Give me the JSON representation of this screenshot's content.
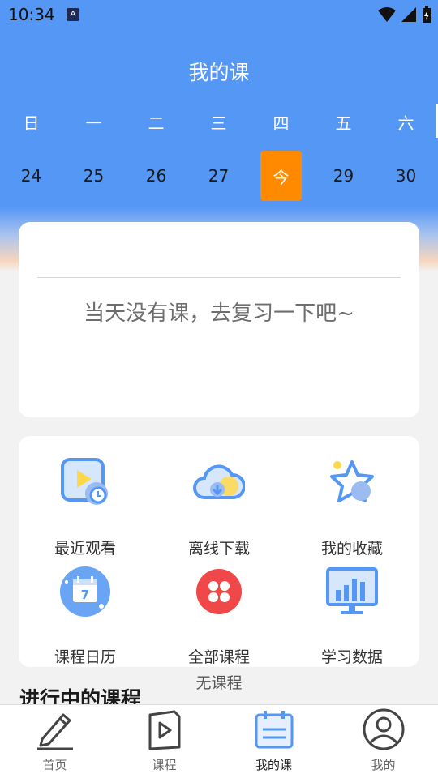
{
  "status_bar": {
    "time": "10:34",
    "notif_glyph": "A"
  },
  "header": {
    "title": "我的课"
  },
  "calendar": {
    "weekdays": [
      "日",
      "一",
      "二",
      "三",
      "四",
      "五",
      "六"
    ],
    "dates": [
      "24",
      "25",
      "26",
      "27",
      "今",
      "29",
      "30"
    ],
    "today_index": 4,
    "today_color": "#ff8a00",
    "header_color": "#5497f5"
  },
  "empty_card": {
    "message": "当天没有课，去复习一下吧~"
  },
  "functions": [
    {
      "label": "最近观看",
      "icon": "recent-watch-icon"
    },
    {
      "label": "离线下载",
      "icon": "offline-download-icon"
    },
    {
      "label": "我的收藏",
      "icon": "favorites-star-icon"
    },
    {
      "label": "课程日历",
      "icon": "course-calendar-icon"
    },
    {
      "label": "全部课程",
      "icon": "all-courses-icon"
    },
    {
      "label": "学习数据",
      "icon": "study-data-icon"
    }
  ],
  "no_course_text": "无课程",
  "section": {
    "in_progress_title": "进行中的课程"
  },
  "tabbar": {
    "tabs": [
      {
        "label": "首页",
        "icon": "home-pencil-icon"
      },
      {
        "label": "课程",
        "icon": "course-play-icon"
      },
      {
        "label": "我的课",
        "icon": "my-class-calendar-icon"
      },
      {
        "label": "我的",
        "icon": "profile-icon"
      }
    ],
    "active_index": 2,
    "active_color": "#5497f5"
  }
}
